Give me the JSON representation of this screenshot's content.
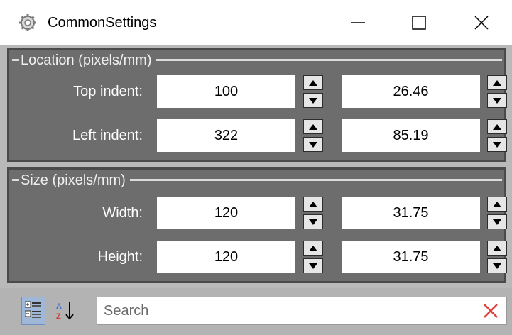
{
  "window": {
    "title": "CommonSettings",
    "icon": "gear-icon",
    "controls": {
      "minimize": "minimize-icon",
      "maximize": "maximize-icon",
      "close": "close-icon"
    }
  },
  "location": {
    "title": "Location (pixels/mm)",
    "rows": [
      {
        "label": "Top indent:",
        "pixels": "100",
        "mm": "26.46"
      },
      {
        "label": "Left indent:",
        "pixels": "322",
        "mm": "85.19"
      }
    ]
  },
  "size": {
    "title": "Size (pixels/mm)",
    "rows": [
      {
        "label": "Width:",
        "pixels": "120",
        "mm": "31.75"
      },
      {
        "label": "Height:",
        "pixels": "120",
        "mm": "31.75"
      }
    ]
  },
  "toolbar": {
    "categorized_icon": "categorized-view-icon",
    "alphabetical_icon": "sort-az-icon"
  },
  "search": {
    "placeholder": "Search",
    "value": "",
    "clear_icon": "clear-search-icon",
    "clear_color": "#e0413a"
  }
}
